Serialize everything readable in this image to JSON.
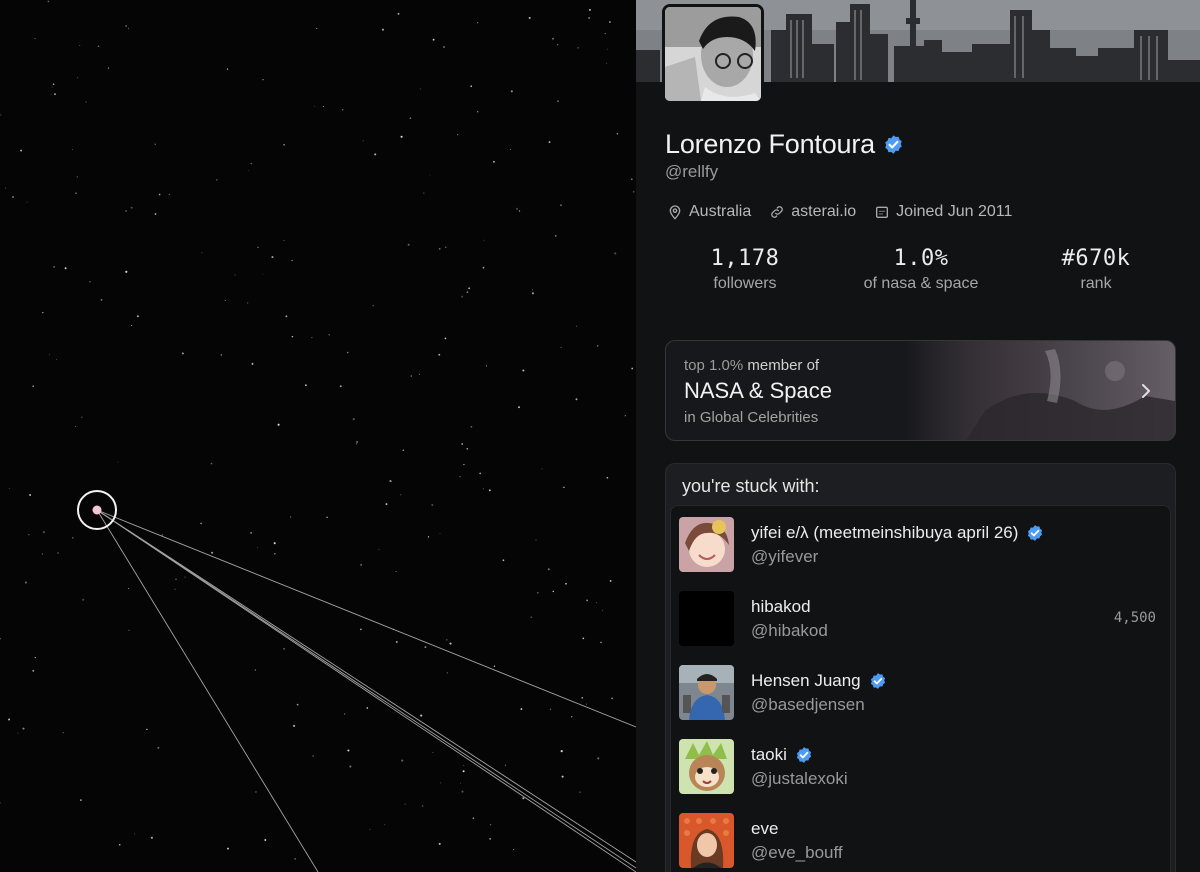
{
  "profile": {
    "name": "Lorenzo Fontoura",
    "handle": "@rellfy",
    "location": "Australia",
    "website": "asterai.io",
    "joined": "Joined Jun 2011"
  },
  "stats": [
    {
      "value": "1,178",
      "label": "followers"
    },
    {
      "value": "1.0%",
      "label": "of nasa & space"
    },
    {
      "value": "#670k",
      "label": "rank"
    }
  ],
  "rank_card": {
    "top_pct": "top 1.0%",
    "member_of": "member of",
    "community": "NASA & Space",
    "context": "in Global Celebrities"
  },
  "stuck": {
    "title": "you're stuck with:",
    "users": [
      {
        "name": "yifei e/λ (meetmeinshibuya april 26)",
        "handle": "@yifever",
        "verified": true,
        "count": ""
      },
      {
        "name": "hibakod",
        "handle": "@hibakod",
        "verified": false,
        "count": "4,500"
      },
      {
        "name": "Hensen Juang",
        "handle": "@basedjensen",
        "verified": true,
        "count": ""
      },
      {
        "name": "taoki",
        "handle": "@justalexoki",
        "verified": true,
        "count": ""
      },
      {
        "name": "eve",
        "handle": "@eve_bouff",
        "verified": false,
        "count": ""
      }
    ]
  },
  "colors": {
    "verified": "#4e9bf5",
    "panel_bg": "#111214",
    "space_bg": "#050505",
    "selected_node": "#f4c6d0"
  },
  "icons": {
    "verified": "verified-badge-icon",
    "location": "map-pin-icon",
    "website": "link-icon",
    "joined": "calendar-icon",
    "card_arrow": "chevron-right-icon"
  }
}
